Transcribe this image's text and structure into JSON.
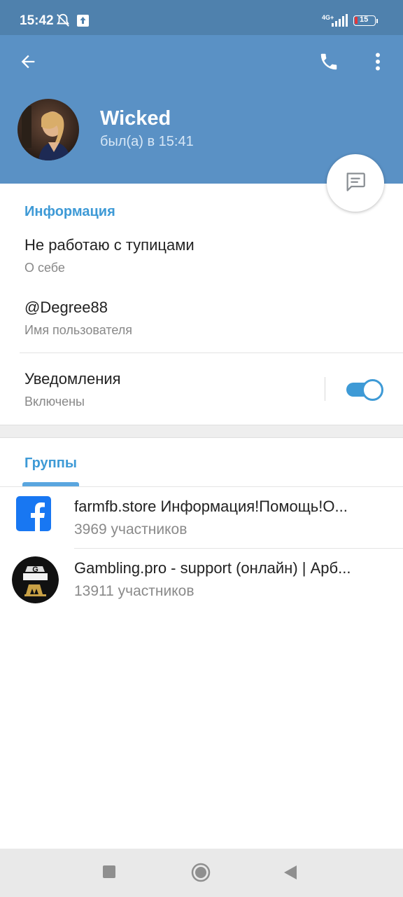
{
  "status_bar": {
    "time": "15:42",
    "battery": "15",
    "network": "4G+",
    "icons": [
      "muted-bell-icon",
      "upload-icon",
      "signal-icon",
      "battery-icon"
    ]
  },
  "header": {
    "name": "Wicked",
    "last_seen": "был(а) в 15:41",
    "icons": [
      "back-arrow-icon",
      "phone-icon",
      "more-vert-icon",
      "message-icon"
    ]
  },
  "info": {
    "section_title": "Информация",
    "bio": "Не работаю с тупицами",
    "bio_label": "О себе",
    "username": "@Degree88",
    "username_label": "Имя пользователя",
    "notifications": "Уведомления",
    "notifications_status": "Включены",
    "notifications_on": true
  },
  "groups": {
    "section_title": "Группы",
    "items": [
      {
        "name": "farmfb.store Информация!Помощь!О...",
        "members": "3969 участников",
        "icon": "facebook-icon"
      },
      {
        "name": "Gambling.pro - support (онлайн) | Арб...",
        "members": "13911 участников",
        "icon": "gambling-logo-icon"
      }
    ]
  },
  "colors": {
    "header_bg": "#5a91c5",
    "status_bg": "#4f81ad",
    "accent": "#3e9ad6"
  },
  "nav": {
    "icons": [
      "recents-square-icon",
      "home-circle-icon",
      "back-triangle-icon"
    ]
  }
}
